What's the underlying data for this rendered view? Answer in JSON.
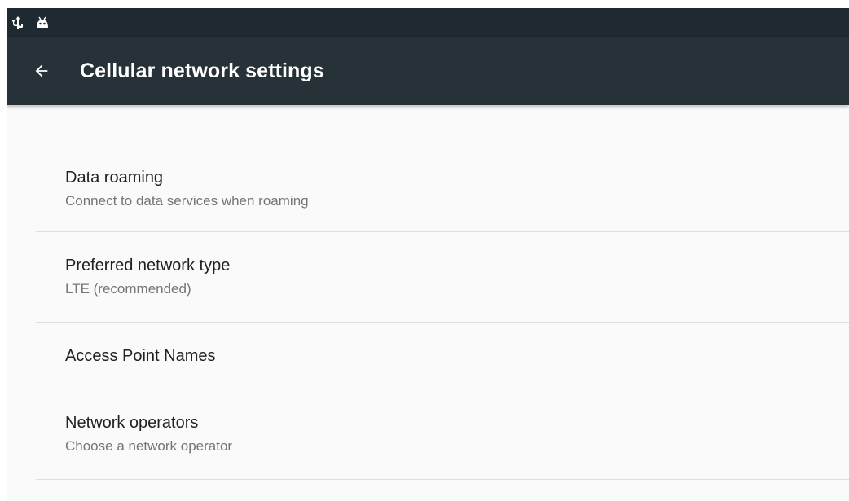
{
  "status_bar": {
    "icons": [
      "usb-icon",
      "android-debug-icon"
    ]
  },
  "toolbar": {
    "title": "Cellular network settings",
    "back_icon": "arrow-back-icon"
  },
  "preferences": [
    {
      "title": "Data roaming",
      "summary": "Connect to data services when roaming"
    },
    {
      "title": "Preferred network type",
      "summary": "LTE (recommended)"
    },
    {
      "title": "Access Point Names",
      "summary": ""
    },
    {
      "title": "Network operators",
      "summary": "Choose a network operator"
    }
  ],
  "colors": {
    "status_bar": "#1e2a30",
    "toolbar": "#263238",
    "background": "#fafafa",
    "title_text": "#212121",
    "summary_text": "#757575"
  }
}
